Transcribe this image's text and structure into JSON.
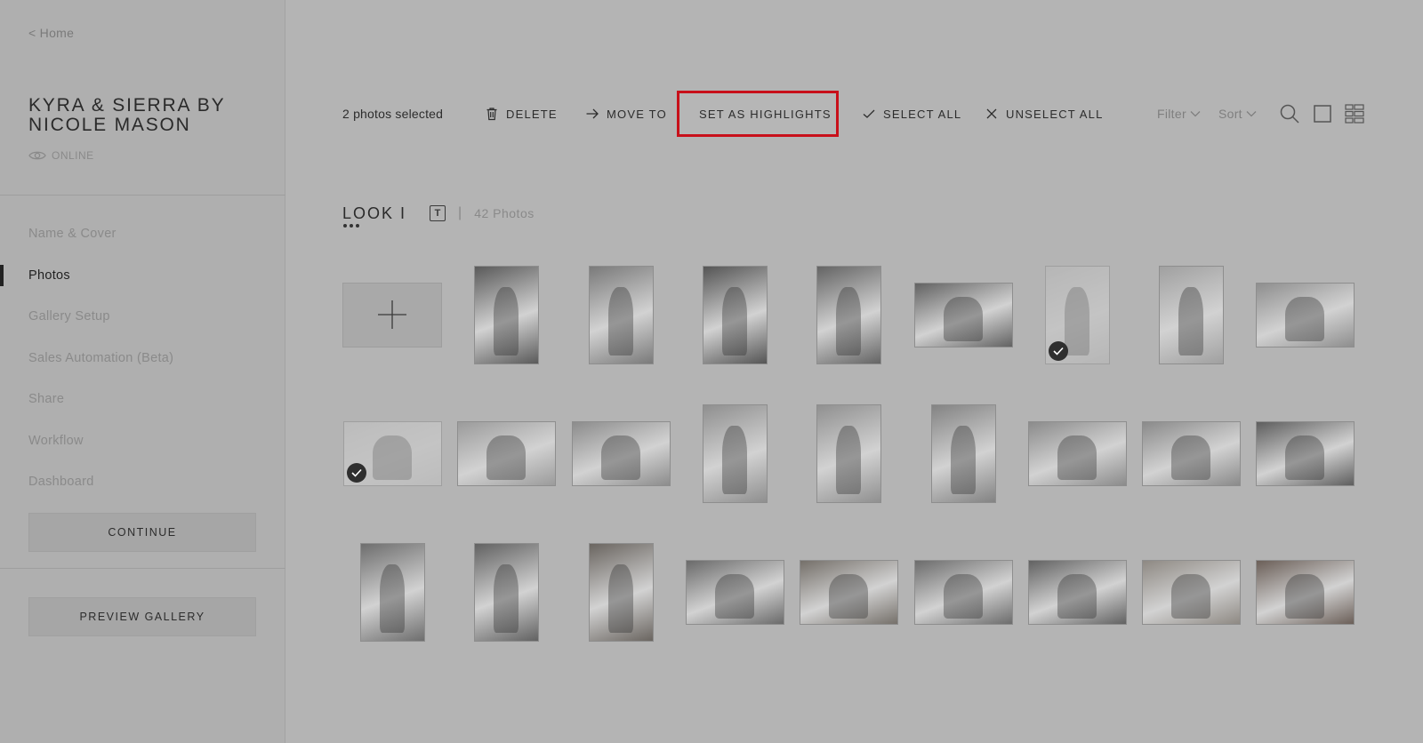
{
  "sidebar": {
    "back_label": "< Home",
    "gallery_title": "KYRA & SIERRA BY NICOLE MASON",
    "status": "ONLINE",
    "nav": [
      {
        "label": "Name & Cover",
        "active": false
      },
      {
        "label": "Photos",
        "active": true
      },
      {
        "label": "Gallery Setup",
        "active": false
      },
      {
        "label": "Sales Automation (Beta)",
        "active": false
      },
      {
        "label": "Share",
        "active": false
      },
      {
        "label": "Workflow",
        "active": false
      },
      {
        "label": "Dashboard",
        "active": false
      }
    ],
    "continue_label": "CONTINUE",
    "preview_label": "PREVIEW GALLERY"
  },
  "toolbar": {
    "selected_text": "2 photos selected",
    "delete_label": "DELETE",
    "move_label": "MOVE TO",
    "highlight_label": "SET AS HIGHLIGHTS",
    "select_all_label": "SELECT ALL",
    "unselect_all_label": "UNSELECT ALL",
    "filter_label": "Filter",
    "sort_label": "Sort"
  },
  "set": {
    "title": "LOOK I",
    "text_icon": "T",
    "separator": "|",
    "count": "42 Photos"
  },
  "photos": [
    {
      "type": "add"
    },
    {
      "orientation": "portrait",
      "tone": "#5a5a5a",
      "selected": false
    },
    {
      "orientation": "portrait",
      "tone": "#7a7a7a",
      "selected": false
    },
    {
      "orientation": "portrait",
      "tone": "#555555",
      "selected": false
    },
    {
      "orientation": "portrait",
      "tone": "#646464",
      "selected": false
    },
    {
      "orientation": "landscape",
      "tone": "#626262",
      "selected": false
    },
    {
      "orientation": "portrait",
      "tone": "#b9b9b9",
      "selected": true
    },
    {
      "orientation": "portrait",
      "tone": "#a0a0a0",
      "selected": false
    },
    {
      "orientation": "landscape",
      "tone": "#8e8e8e",
      "selected": false
    },
    {
      "orientation": "landscape",
      "tone": "#c3c3c3",
      "selected": true
    },
    {
      "orientation": "landscape",
      "tone": "#9b9b9b",
      "selected": false
    },
    {
      "orientation": "landscape",
      "tone": "#8c8c8c",
      "selected": false
    },
    {
      "orientation": "portrait",
      "tone": "#8f8f8f",
      "selected": false
    },
    {
      "orientation": "portrait",
      "tone": "#909090",
      "selected": false
    },
    {
      "orientation": "portrait",
      "tone": "#838383",
      "selected": false
    },
    {
      "orientation": "landscape",
      "tone": "#8b8b8b",
      "selected": false
    },
    {
      "orientation": "landscape",
      "tone": "#8a8a8a",
      "selected": false
    },
    {
      "orientation": "landscape",
      "tone": "#5e5e5e",
      "selected": false
    },
    {
      "orientation": "portrait",
      "tone": "#6e6e6e",
      "selected": false
    },
    {
      "orientation": "portrait",
      "tone": "#626262",
      "selected": false
    },
    {
      "orientation": "portrait",
      "tone": "#6a6560",
      "selected": false
    },
    {
      "orientation": "landscape",
      "tone": "#6a6a6a",
      "selected": false
    },
    {
      "orientation": "landscape",
      "tone": "#75706a",
      "selected": false
    },
    {
      "orientation": "landscape",
      "tone": "#6c6c6c",
      "selected": false
    },
    {
      "orientation": "landscape",
      "tone": "#626262",
      "selected": false
    },
    {
      "orientation": "landscape",
      "tone": "#8e8983",
      "selected": false
    },
    {
      "orientation": "landscape",
      "tone": "#6b5f58",
      "selected": false
    }
  ],
  "colors": {
    "highlight_border": "#c8101a",
    "overlay": "#b4b4b4"
  }
}
